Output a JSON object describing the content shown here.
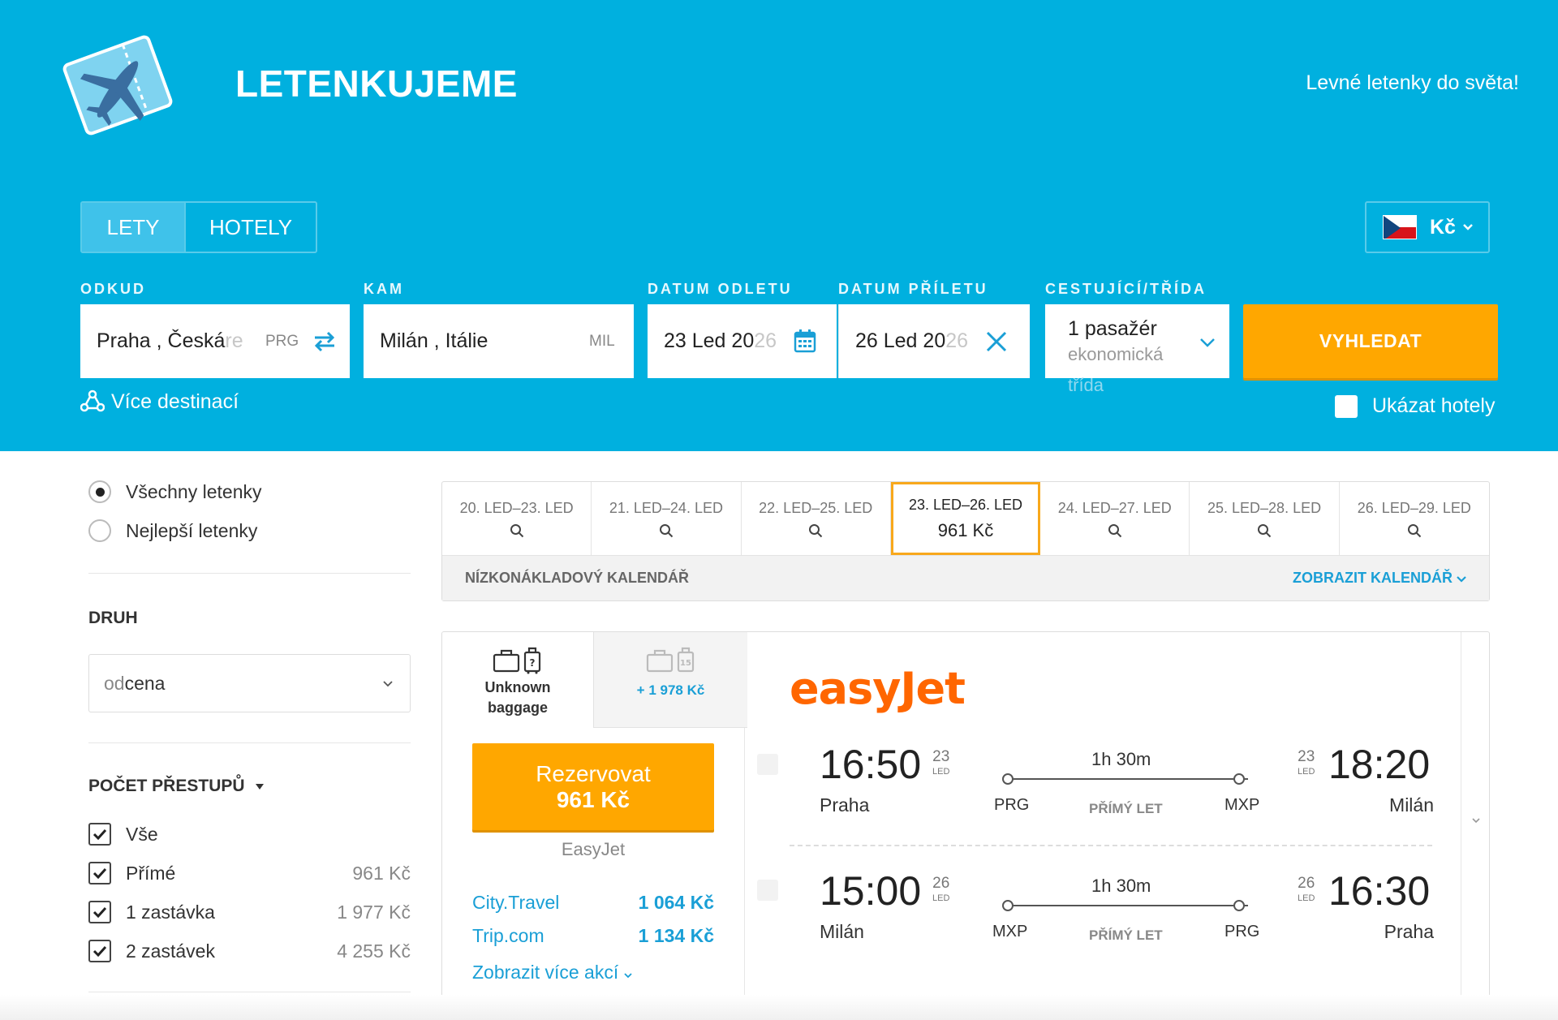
{
  "header": {
    "brand": "LETENKUJEME",
    "tagline": "Levné letenky do světa!",
    "tabs": [
      {
        "label": "LETY"
      },
      {
        "label": "HOTELY"
      }
    ],
    "currency": "Kč"
  },
  "search": {
    "from_label": "ODKUD",
    "from_value": "Praha , Česká ",
    "from_value_fade": "re",
    "from_code": "PRG",
    "to_label": "KAM",
    "to_value": "Milán , Itálie",
    "to_code": "MIL",
    "depart_label": "DATUM ODLETU",
    "depart_value": "23 Led 20",
    "depart_value_fade": "26",
    "return_label": "DATUM PŘÍLETU",
    "return_value": "26 Led 20",
    "return_value_fade": "26",
    "pax_label": "CESTUJÍCÍ/TŘÍDA",
    "pax_value": "1 pasažér",
    "class_line1": "ekonomická",
    "class_line2": "třída",
    "search_button": "VYHLEDAT",
    "more_destinations": "Více destinací",
    "show_hotels": "Ukázat hotely"
  },
  "sidebar": {
    "radio_all": "Všechny letenky",
    "radio_best": "Nejlepší letenky",
    "sort_title": "DRUH",
    "sort_prefix": "od",
    "sort_value": " cena",
    "stops_title": "POČET PŘESTUPŮ",
    "stops": [
      {
        "label": "Vše",
        "price": ""
      },
      {
        "label": "Přímé",
        "price": "961 Kč"
      },
      {
        "label": "1 zastávka",
        "price": "1 977 Kč"
      },
      {
        "label": "2 zastávek",
        "price": "4 255 Kč"
      }
    ]
  },
  "calendar": {
    "days": [
      {
        "range": "20. LED–23. LED",
        "price": ""
      },
      {
        "range": "21. LED–24. LED",
        "price": ""
      },
      {
        "range": "22. LED–25. LED",
        "price": ""
      },
      {
        "range": "23. LED–26. LED",
        "price": "961 Kč"
      },
      {
        "range": "24. LED–27. LED",
        "price": ""
      },
      {
        "range": "25. LED–28. LED",
        "price": ""
      },
      {
        "range": "26. LED–29. LED",
        "price": ""
      }
    ],
    "footer_left": "NÍZKONÁKLADOVÝ KALENDÁŘ",
    "footer_right": "ZOBRAZIT KALENDÁŘ"
  },
  "result": {
    "baggage_line1": "Unknown",
    "baggage_line2": "baggage",
    "baggage_extra": "+ 1 978 Kč",
    "baggage_count": "15",
    "book_label": "Rezervovat",
    "book_price": "961 Kč",
    "vendor": "EasyJet",
    "offers": [
      {
        "name": "City.Travel",
        "price": "1 064 Kč"
      },
      {
        "name": "Trip.com",
        "price": "1 134 Kč"
      }
    ],
    "more_offers": "Zobrazit více akcí",
    "airline": "easyJet",
    "legs": [
      {
        "dep_time": "16:50",
        "dep_day": "23",
        "dep_month": "LED",
        "dep_city": "Praha",
        "dep_code": "PRG",
        "duration": "1h 30m",
        "type": "PŘÍMÝ LET",
        "arr_time": "18:20",
        "arr_day": "23",
        "arr_month": "LED",
        "arr_city": "Milán",
        "arr_code": "MXP"
      },
      {
        "dep_time": "15:00",
        "dep_day": "26",
        "dep_month": "LED",
        "dep_city": "Milán",
        "dep_code": "MXP",
        "duration": "1h 30m",
        "type": "PŘÍMÝ LET",
        "arr_time": "16:30",
        "arr_day": "26",
        "arr_month": "LED",
        "arr_city": "Praha",
        "arr_code": "PRG"
      }
    ]
  },
  "colors": {
    "header": "#00b0df",
    "accent": "#ffa700",
    "link": "#1a9fd6",
    "airline": "#ff6600"
  }
}
